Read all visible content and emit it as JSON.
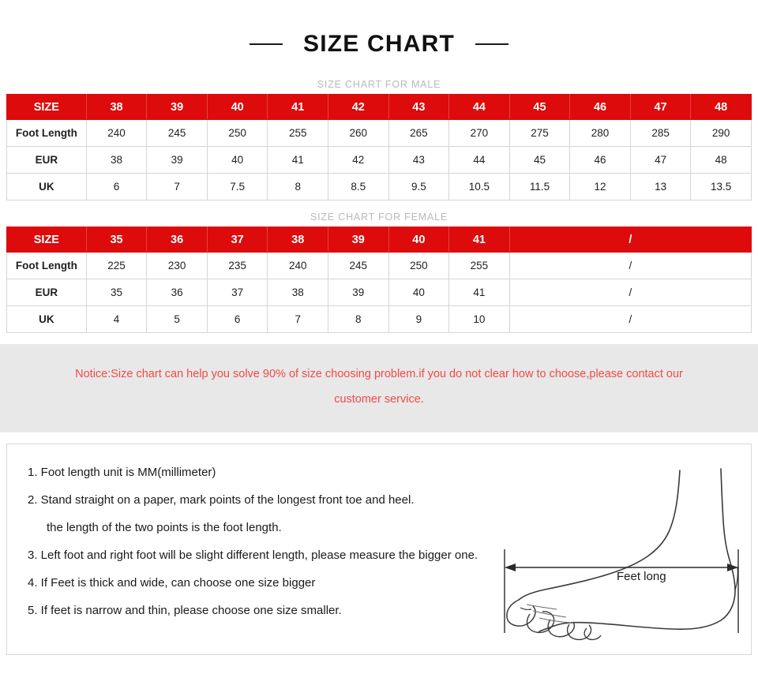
{
  "header": {
    "title": "SIZE CHART",
    "dash_left": "—",
    "dash_right": "—"
  },
  "male_section": {
    "subtitle": "SIZE CHART FOR MALE",
    "row_labels": [
      "SIZE",
      "Foot Length",
      "EUR",
      "UK"
    ],
    "sizes": [
      "38",
      "39",
      "40",
      "41",
      "42",
      "43",
      "44",
      "45",
      "46",
      "47",
      "48"
    ],
    "foot_length": [
      "240",
      "245",
      "250",
      "255",
      "260",
      "265",
      "270",
      "275",
      "280",
      "285",
      "290"
    ],
    "eur": [
      "38",
      "39",
      "40",
      "41",
      "42",
      "43",
      "44",
      "45",
      "46",
      "47",
      "48"
    ],
    "uk": [
      "6",
      "7",
      "7.5",
      "8",
      "8.5",
      "9.5",
      "10.5",
      "11.5",
      "12",
      "13",
      "13.5"
    ]
  },
  "female_section": {
    "subtitle": "SIZE CHART FOR FEMALE",
    "row_labels": [
      "SIZE",
      "Foot Length",
      "EUR",
      "UK"
    ],
    "sizes": [
      "35",
      "36",
      "37",
      "38",
      "39",
      "40",
      "41"
    ],
    "foot_length": [
      "225",
      "230",
      "235",
      "240",
      "245",
      "250",
      "255"
    ],
    "eur": [
      "35",
      "36",
      "37",
      "38",
      "39",
      "40",
      "41"
    ],
    "uk": [
      "4",
      "5",
      "6",
      "7",
      "8",
      "9",
      "10"
    ],
    "merged_placeholder": "/",
    "merged_span": 4
  },
  "notice": {
    "line1": "Notice:Size chart can help you solve 90% of size choosing problem.if you do not clear how to choose,please contact our",
    "line2": "customer service.",
    "color": "#ef4a4a"
  },
  "instructions": {
    "lines": [
      "1. Foot length unit is MM(millimeter)",
      "2. Stand straight on a paper, mark points of the longest front toe and heel.",
      "the length of the two points is the foot length.",
      "3. Left foot and right foot will be slight different length, please measure the bigger one.",
      "4. If Feet is thick and wide, can choose one size bigger",
      "5. If feet is narrow and thin, please choose one size smaller."
    ],
    "indent_flags": [
      false,
      false,
      true,
      false,
      false,
      false
    ]
  },
  "figure": {
    "label": "Feet long",
    "alt": "foot-side-view-diagram"
  },
  "colors": {
    "header_red": "#dd0b0b",
    "notice_bg": "#e8e8e8",
    "notice_text": "#ef4a4a",
    "subtitle_gray": "#b9b9b9",
    "border": "#d5d5d5"
  }
}
